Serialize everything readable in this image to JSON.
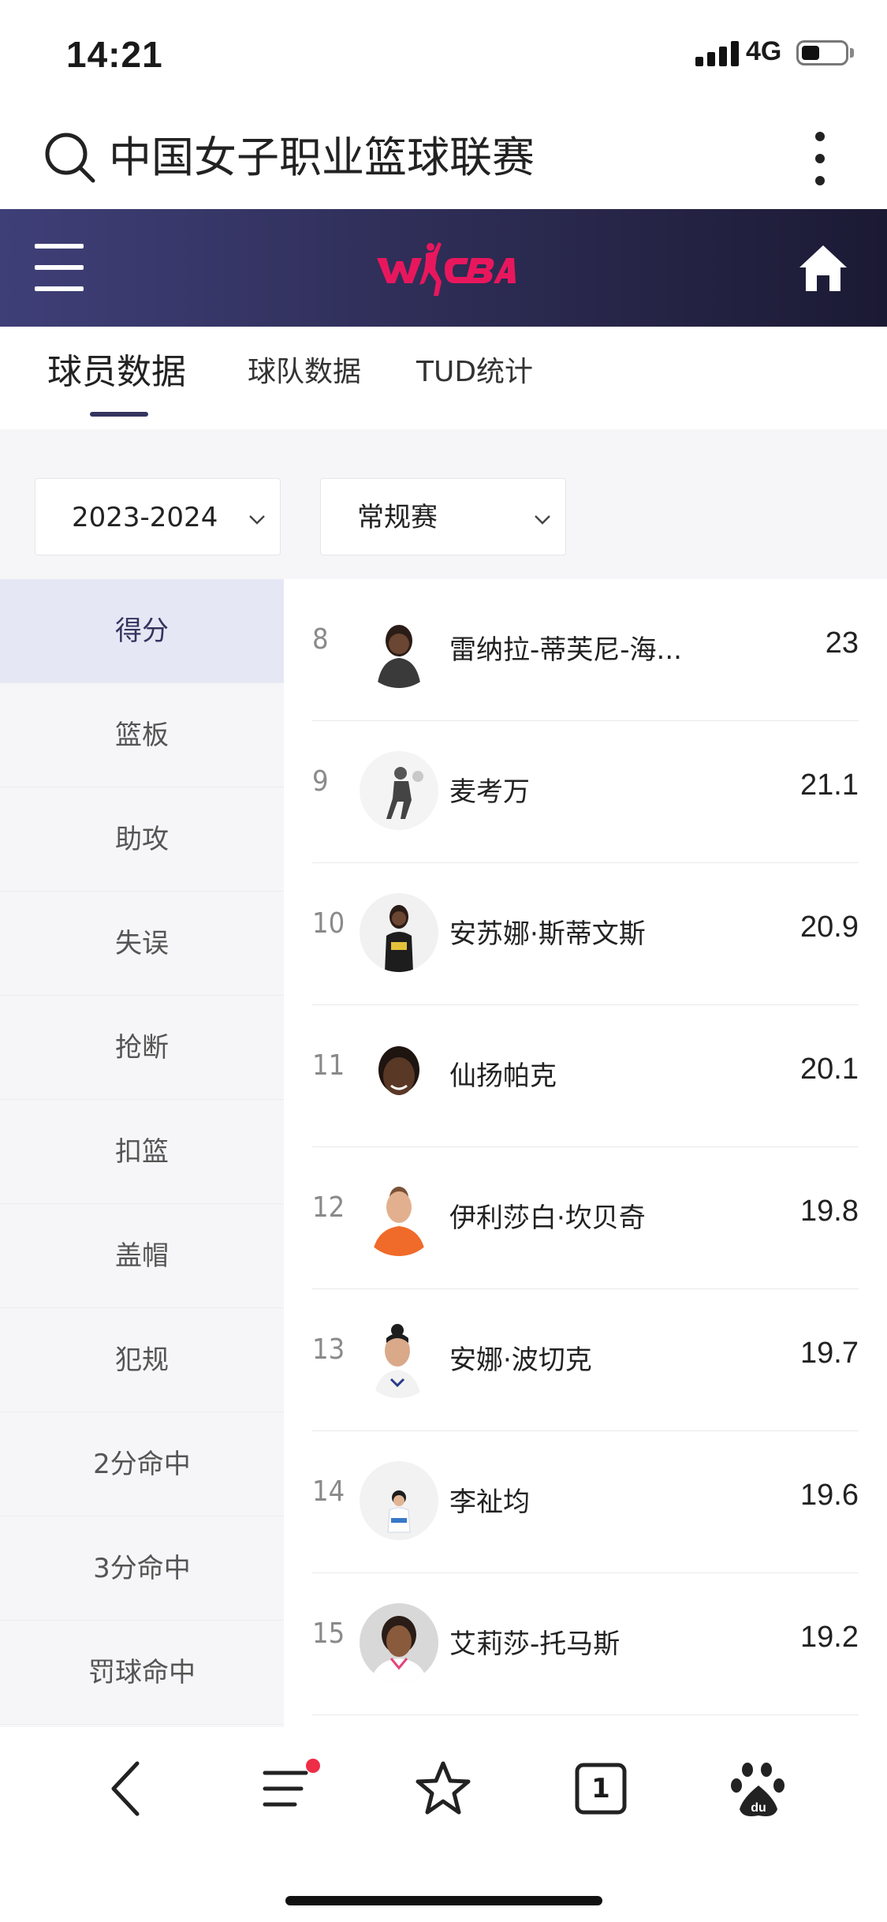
{
  "status": {
    "time": "14:21",
    "network": "4G"
  },
  "search": {
    "query": "中国女子职业篮球联赛"
  },
  "header": {
    "logo_text": "WCBA",
    "brand_color": "#e8175d",
    "background": "#2c2b52"
  },
  "tabs": [
    {
      "label": "球员数据",
      "active": true
    },
    {
      "label": "球队数据",
      "active": false
    },
    {
      "label": "TUD统计",
      "active": false
    }
  ],
  "filters": {
    "season": "2023-2024",
    "game_type": "常规赛"
  },
  "categories": [
    {
      "label": "得分",
      "active": true
    },
    {
      "label": "篮板"
    },
    {
      "label": "助攻"
    },
    {
      "label": "失误"
    },
    {
      "label": "抢断"
    },
    {
      "label": "扣篮"
    },
    {
      "label": "盖帽"
    },
    {
      "label": "犯规"
    },
    {
      "label": "2分命中"
    },
    {
      "label": "3分命中"
    },
    {
      "label": "罚球命中"
    }
  ],
  "rankings": [
    {
      "rank": "8",
      "name": "雷纳拉-蒂芙尼-海...",
      "value": "23"
    },
    {
      "rank": "9",
      "name": "麦考万",
      "value": "21.1"
    },
    {
      "rank": "10",
      "name": "安苏娜·斯蒂文斯",
      "value": "20.9"
    },
    {
      "rank": "11",
      "name": "仙扬帕克",
      "value": "20.1"
    },
    {
      "rank": "12",
      "name": "伊利莎白·坎贝奇",
      "value": "19.8"
    },
    {
      "rank": "13",
      "name": "安娜·波切克",
      "value": "19.7"
    },
    {
      "rank": "14",
      "name": "李祉均",
      "value": "19.6"
    },
    {
      "rank": "15",
      "name": "艾莉莎-托马斯",
      "value": "19.2"
    }
  ],
  "bottom_nav": {
    "tab_count": "1",
    "icons": [
      "back-icon",
      "menu-list-icon",
      "star-icon",
      "tabs-icon",
      "baidu-icon"
    ]
  }
}
